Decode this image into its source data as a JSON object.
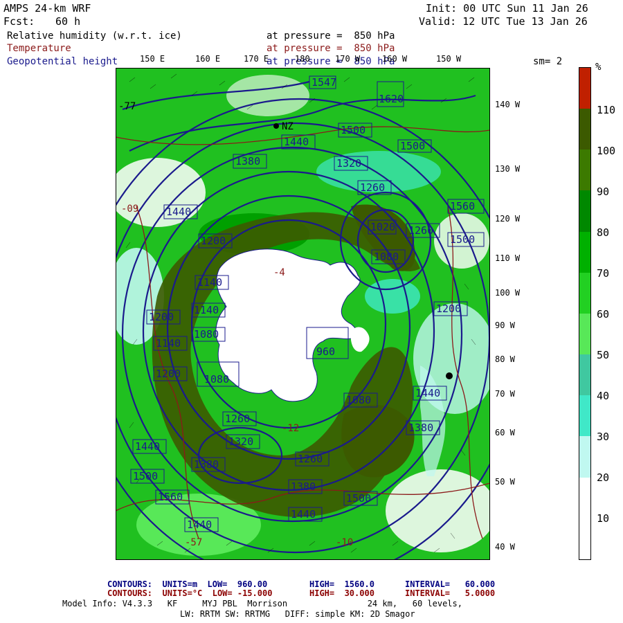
{
  "header": {
    "model": "AMPS 24-km WRF",
    "fcst_label": "Fcst:",
    "fcst_value": "60 h",
    "init": "Init: 00 UTC Sun 11 Jan 26",
    "valid": "Valid: 12 UTC Tue 13 Jan 26"
  },
  "fields": [
    {
      "name": "Relative humidity (w.r.t. ice)",
      "level": "at pressure =  850 hPa",
      "color": "#000000"
    },
    {
      "name": "Temperature",
      "level": "at pressure =  850 hPa",
      "color": "#8b1a1a"
    },
    {
      "name": "Geopotential height",
      "level": "at pressure =  850 hPa",
      "color": "#1a1a8c"
    }
  ],
  "sm_label": "sm= 2",
  "lon_top": [
    "150 E",
    "160 E",
    "170 E",
    "180",
    "170 W",
    "160 W",
    "150 W"
  ],
  "lon_right": [
    "140 W",
    "130 W",
    "120 W",
    "110 W",
    "100 W",
    "90 W",
    "80 W",
    "70 W",
    "60 W",
    "50 W",
    "40 W"
  ],
  "colorbar": {
    "unit": "%",
    "labels": [
      "110",
      "100",
      "90",
      "80",
      "70",
      "60",
      "50",
      "40",
      "30",
      "20",
      "10"
    ],
    "colors": [
      "#c02000",
      "#3c5a00",
      "#3c7a00",
      "#008800",
      "#00b000",
      "#22d022",
      "#58e858",
      "#40c8a0",
      "#40e8c8",
      "#c0f8f0",
      "#ffffff",
      "#ffffff"
    ]
  },
  "map": {
    "colors": {
      "land": "#ffffff",
      "ocean_base": "#20c020",
      "dark_band": "#3c5a00",
      "mid_green": "#00a000",
      "light_green": "#58e858",
      "teal": "#40e8c8",
      "pale": "#c0f8f0",
      "height_contour": "#1a1a8c",
      "temp_contour": "#8b1a1a"
    },
    "height_labels": [
      "1547",
      "1620",
      "1500",
      "1440",
      "1500",
      "1380",
      "1320",
      "1440",
      "1260",
      "1080",
      "1020",
      "1200",
      "1560",
      "1500",
      "1260",
      "1140",
      "1080",
      "1140",
      "1200",
      "1140",
      "1200",
      "1260",
      "1080",
      "1320",
      "1380",
      "1440",
      "1500",
      "1560",
      "1260",
      "1380",
      "1440",
      "1500",
      "1380",
      "1440",
      "960",
      "1200",
      "1080",
      "1440"
    ],
    "other_labels": [
      "NZ",
      "-77",
      "-09",
      "-57",
      "-10",
      "-12",
      "-4"
    ]
  },
  "footer": {
    "line1": {
      "label": "CONTOURS:  UNITS=m  LOW=  960.00",
      "high": "HIGH=  1560.0",
      "interval": "INTERVAL=   60.000"
    },
    "line2": {
      "label": "CONTOURS:  UNITS=°C  LOW= -15.000",
      "high": "HIGH=  30.000",
      "interval": "INTERVAL=   5.0000"
    },
    "line3": "Model Info: V4.3.3   KF     MYJ PBL  Morrison                24 km,   60 levels,",
    "line4": "LW: RRTM SW: RRTMG   DIFF: simple KM: 2D Smagor"
  }
}
